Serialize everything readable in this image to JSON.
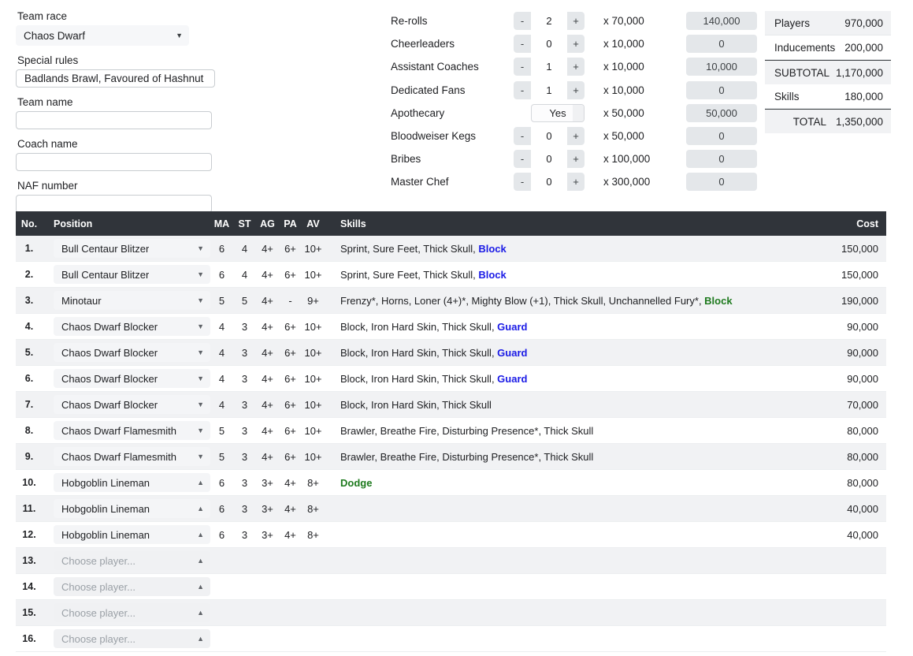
{
  "team_form": {
    "race_label": "Team race",
    "race_value": "Chaos Dwarf",
    "special_rules_label": "Special rules",
    "special_rules_value": "Badlands Brawl, Favoured of Hashnut",
    "team_name_label": "Team name",
    "team_name_value": "",
    "coach_name_label": "Coach name",
    "coach_name_value": "",
    "naf_label": "NAF number",
    "naf_value": ""
  },
  "inducements": {
    "rows": [
      {
        "name": "Re-rolls",
        "minus": "-",
        "count": "2",
        "plus": "+",
        "mult": "x 70,000",
        "total": "140,000",
        "type": "stepper"
      },
      {
        "name": "Cheerleaders",
        "minus": "-",
        "count": "0",
        "plus": "+",
        "mult": "x 10,000",
        "total": "0",
        "type": "stepper"
      },
      {
        "name": "Assistant Coaches",
        "minus": "-",
        "count": "1",
        "plus": "+",
        "mult": "x 10,000",
        "total": "10,000",
        "type": "stepper"
      },
      {
        "name": "Dedicated Fans",
        "minus": "-",
        "count": "1",
        "plus": "+",
        "mult": "x 10,000",
        "total": "0",
        "type": "stepper"
      },
      {
        "name": "Apothecary",
        "minus": "",
        "count": "Yes",
        "plus": "",
        "mult": "x 50,000",
        "total": "50,000",
        "type": "toggle"
      },
      {
        "name": "Bloodweiser Kegs",
        "minus": "-",
        "count": "0",
        "plus": "+",
        "mult": "x 50,000",
        "total": "0",
        "type": "stepper"
      },
      {
        "name": "Bribes",
        "minus": "-",
        "count": "0",
        "plus": "+",
        "mult": "x 100,000",
        "total": "0",
        "type": "stepper"
      },
      {
        "name": "Master Chef",
        "minus": "-",
        "count": "0",
        "plus": "+",
        "mult": "x 300,000",
        "total": "0",
        "type": "stepper"
      }
    ]
  },
  "totals": {
    "rows": [
      {
        "label": "Players",
        "value": "970,000",
        "shaded": true,
        "rule": false,
        "align_right": false
      },
      {
        "label": "Inducements",
        "value": "200,000",
        "shaded": false,
        "rule": false,
        "align_right": false
      },
      {
        "label": "SUBTOTAL",
        "value": "1,170,000",
        "shaded": true,
        "rule": true,
        "align_right": true
      },
      {
        "label": "Skills",
        "value": "180,000",
        "shaded": false,
        "rule": false,
        "align_right": false
      },
      {
        "label": "TOTAL",
        "value": "1,350,000",
        "shaded": true,
        "rule": true,
        "align_right": true
      }
    ]
  },
  "roster": {
    "headers": {
      "no": "No.",
      "position": "Position",
      "ma": "MA",
      "st": "ST",
      "ag": "AG",
      "pa": "PA",
      "av": "AV",
      "skills": "Skills",
      "cost": "Cost"
    },
    "placeholder": "Choose player...",
    "caret_down": "▼",
    "caret_up": "▲",
    "rows": [
      {
        "no": "1.",
        "position": "Bull Centaur Blitzer",
        "caret": "down",
        "ma": "6",
        "st": "4",
        "ag": "4+",
        "pa": "6+",
        "av": "10+",
        "skills_plain": "Sprint, Sure Feet, Thick Skull, ",
        "skill_hl": "Block",
        "hl_color": "blue",
        "cost": "150,000"
      },
      {
        "no": "2.",
        "position": "Bull Centaur Blitzer",
        "caret": "down",
        "ma": "6",
        "st": "4",
        "ag": "4+",
        "pa": "6+",
        "av": "10+",
        "skills_plain": "Sprint, Sure Feet, Thick Skull, ",
        "skill_hl": "Block",
        "hl_color": "blue",
        "cost": "150,000"
      },
      {
        "no": "3.",
        "position": "Minotaur",
        "caret": "down",
        "ma": "5",
        "st": "5",
        "ag": "4+",
        "pa": "-",
        "av": "9+",
        "skills_plain": "Frenzy*, Horns, Loner (4+)*, Mighty Blow (+1), Thick Skull, Unchannelled Fury*, ",
        "skill_hl": "Block",
        "hl_color": "green",
        "cost": "190,000"
      },
      {
        "no": "4.",
        "position": "Chaos Dwarf Blocker",
        "caret": "down",
        "ma": "4",
        "st": "3",
        "ag": "4+",
        "pa": "6+",
        "av": "10+",
        "skills_plain": "Block, Iron Hard Skin, Thick Skull, ",
        "skill_hl": "Guard",
        "hl_color": "blue",
        "cost": "90,000"
      },
      {
        "no": "5.",
        "position": "Chaos Dwarf Blocker",
        "caret": "down",
        "ma": "4",
        "st": "3",
        "ag": "4+",
        "pa": "6+",
        "av": "10+",
        "skills_plain": "Block, Iron Hard Skin, Thick Skull, ",
        "skill_hl": "Guard",
        "hl_color": "blue",
        "cost": "90,000"
      },
      {
        "no": "6.",
        "position": "Chaos Dwarf Blocker",
        "caret": "down",
        "ma": "4",
        "st": "3",
        "ag": "4+",
        "pa": "6+",
        "av": "10+",
        "skills_plain": "Block, Iron Hard Skin, Thick Skull, ",
        "skill_hl": "Guard",
        "hl_color": "blue",
        "cost": "90,000"
      },
      {
        "no": "7.",
        "position": "Chaos Dwarf Blocker",
        "caret": "down",
        "ma": "4",
        "st": "3",
        "ag": "4+",
        "pa": "6+",
        "av": "10+",
        "skills_plain": "Block, Iron Hard Skin, Thick Skull",
        "skill_hl": "",
        "hl_color": "",
        "cost": "70,000"
      },
      {
        "no": "8.",
        "position": "Chaos Dwarf Flamesmith",
        "caret": "down",
        "ma": "5",
        "st": "3",
        "ag": "4+",
        "pa": "6+",
        "av": "10+",
        "skills_plain": "Brawler, Breathe Fire, Disturbing Presence*, Thick Skull",
        "skill_hl": "",
        "hl_color": "",
        "cost": "80,000"
      },
      {
        "no": "9.",
        "position": "Chaos Dwarf Flamesmith",
        "caret": "down",
        "ma": "5",
        "st": "3",
        "ag": "4+",
        "pa": "6+",
        "av": "10+",
        "skills_plain": "Brawler, Breathe Fire, Disturbing Presence*, Thick Skull",
        "skill_hl": "",
        "hl_color": "",
        "cost": "80,000"
      },
      {
        "no": "10.",
        "position": "Hobgoblin Lineman",
        "caret": "up",
        "ma": "6",
        "st": "3",
        "ag": "3+",
        "pa": "4+",
        "av": "8+",
        "skills_plain": "",
        "skill_hl": "Dodge",
        "hl_color": "green",
        "cost": "80,000"
      },
      {
        "no": "11.",
        "position": "Hobgoblin Lineman",
        "caret": "up",
        "ma": "6",
        "st": "3",
        "ag": "3+",
        "pa": "4+",
        "av": "8+",
        "skills_plain": "",
        "skill_hl": "",
        "hl_color": "",
        "cost": "40,000"
      },
      {
        "no": "12.",
        "position": "Hobgoblin Lineman",
        "caret": "up",
        "ma": "6",
        "st": "3",
        "ag": "3+",
        "pa": "4+",
        "av": "8+",
        "skills_plain": "",
        "skill_hl": "",
        "hl_color": "",
        "cost": "40,000"
      },
      {
        "no": "13.",
        "position": "",
        "caret": "up",
        "ma": "",
        "st": "",
        "ag": "",
        "pa": "",
        "av": "",
        "skills_plain": "",
        "skill_hl": "",
        "hl_color": "",
        "cost": ""
      },
      {
        "no": "14.",
        "position": "",
        "caret": "up",
        "ma": "",
        "st": "",
        "ag": "",
        "pa": "",
        "av": "",
        "skills_plain": "",
        "skill_hl": "",
        "hl_color": "",
        "cost": ""
      },
      {
        "no": "15.",
        "position": "",
        "caret": "up",
        "ma": "",
        "st": "",
        "ag": "",
        "pa": "",
        "av": "",
        "skills_plain": "",
        "skill_hl": "",
        "hl_color": "",
        "cost": ""
      },
      {
        "no": "16.",
        "position": "",
        "caret": "up",
        "ma": "",
        "st": "",
        "ag": "",
        "pa": "",
        "av": "",
        "skills_plain": "",
        "skill_hl": "",
        "hl_color": "",
        "cost": ""
      }
    ]
  },
  "colors": {
    "header_bg": "#30343a",
    "row_alt_bg": "#f1f2f4",
    "skill_blue": "#1a1ae6",
    "skill_green": "#1e7a1e"
  }
}
